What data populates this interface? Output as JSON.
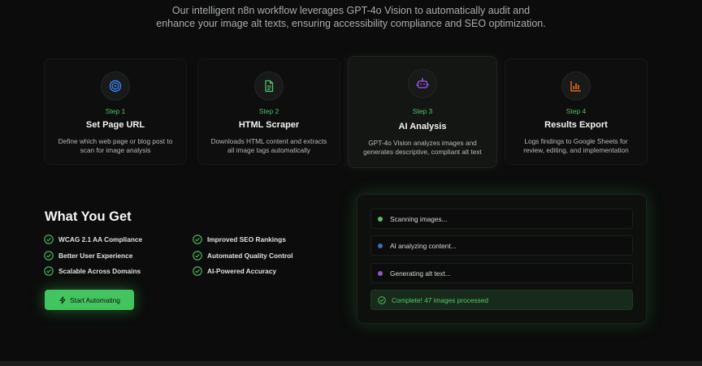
{
  "intro": {
    "line1": "Our intelligent n8n workflow leverages GPT-4o Vision to automatically audit and",
    "line2": "enhance your image alt texts, ensuring accessibility compliance and SEO optimization."
  },
  "steps": [
    {
      "step": "Step 1",
      "title": "Set Page URL",
      "desc": "Define which web page or blog post to scan for image analysis",
      "icon": "target-icon",
      "color": "#3b82f6"
    },
    {
      "step": "Step 2",
      "title": "HTML Scraper",
      "desc": "Downloads HTML content and extracts all image tags automatically",
      "icon": "document-icon",
      "color": "#4fc266"
    },
    {
      "step": "Step 3",
      "title": "AI Analysis",
      "desc": "GPT-4o Vision analyzes images and generates descriptive, compliant alt text",
      "icon": "robot-icon",
      "color": "#a855f7"
    },
    {
      "step": "Step 4",
      "title": "Results Export",
      "desc": "Logs findings to Google Sheets for review, editing, and implementation",
      "icon": "bar-chart-icon",
      "color": "#f97316"
    }
  ],
  "what_you_get": {
    "title": "What You Get",
    "benefits": [
      "WCAG 2.1 AA Compliance",
      "Improved SEO Rankings",
      "Better User Experience",
      "Automated Quality Control",
      "Scalable Across Domains",
      "AI-Powered Accuracy"
    ],
    "cta_label": "Start Automating"
  },
  "status": {
    "rows": [
      {
        "label": "Scanning images...",
        "dot_color": "#4fc266"
      },
      {
        "label": "AI analyzing content...",
        "dot_color": "#3b6fb0"
      },
      {
        "label": "Generating alt text...",
        "dot_color": "#8b5cc0"
      }
    ],
    "complete": "Complete! 47 images processed"
  },
  "colors": {
    "accent": "#44c45f",
    "background": "#0b0c0b"
  }
}
